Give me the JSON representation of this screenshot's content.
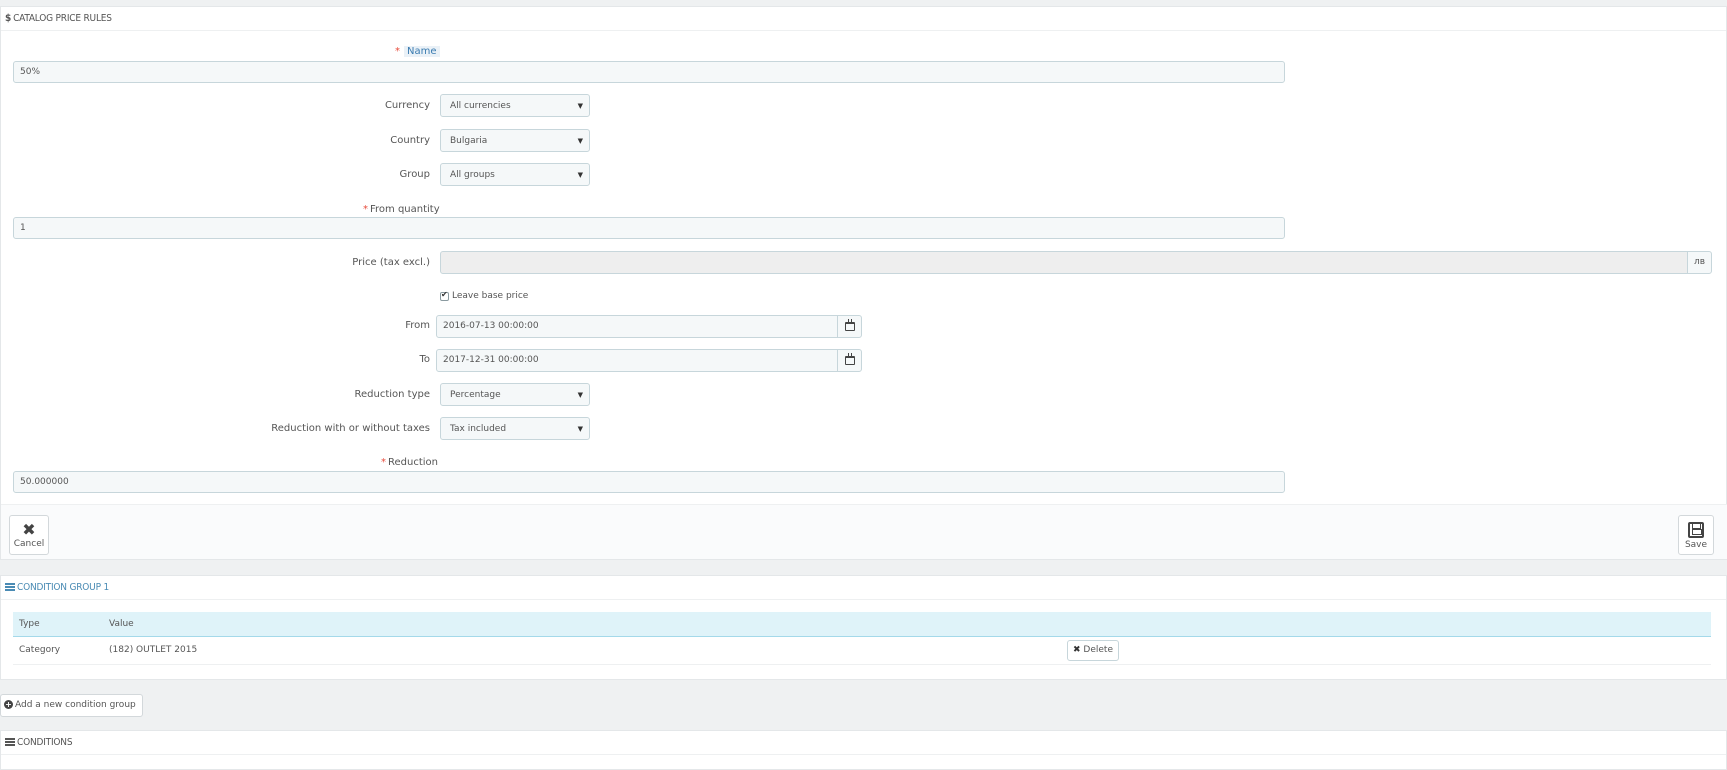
{
  "header": {
    "title": "CATALOG PRICE RULES",
    "icon": "dollar-icon"
  },
  "form": {
    "name_label": "Name",
    "name_value": "50%",
    "currency_label": "Currency",
    "currency_value": "All currencies",
    "country_label": "Country",
    "country_value": "Bulgaria",
    "group_label": "Group",
    "group_value": "All groups",
    "from_quantity_label": "From quantity",
    "from_quantity_value": "1",
    "price_label": "Price (tax excl.)",
    "price_value": "",
    "price_unit": "лв",
    "leave_base_price_label": "Leave base price",
    "leave_base_price_checked": true,
    "from_label": "From",
    "from_value": "2016-07-13 00:00:00",
    "to_label": "To",
    "to_value": "2017-12-31 00:00:00",
    "reduction_type_label": "Reduction type",
    "reduction_type_value": "Percentage",
    "reduction_tax_label": "Reduction with or without taxes",
    "reduction_tax_value": "Tax included",
    "reduction_label": "Reduction",
    "reduction_value": "50.000000",
    "required_marker": "*"
  },
  "footer": {
    "cancel_label": "Cancel",
    "save_label": "Save"
  },
  "condition_group": {
    "title": "CONDITION GROUP 1",
    "columns": [
      "Type",
      "Value"
    ],
    "rows": [
      {
        "type": "Category",
        "value": "(182) OUTLET 2015",
        "action": "Delete"
      }
    ]
  },
  "add_group_label": "Add a new condition group",
  "conditions_title": "CONDITIONS",
  "colors": {
    "required": "#e74c3c",
    "accent": "#4a8bb4",
    "table_head": "#dff3f9"
  }
}
